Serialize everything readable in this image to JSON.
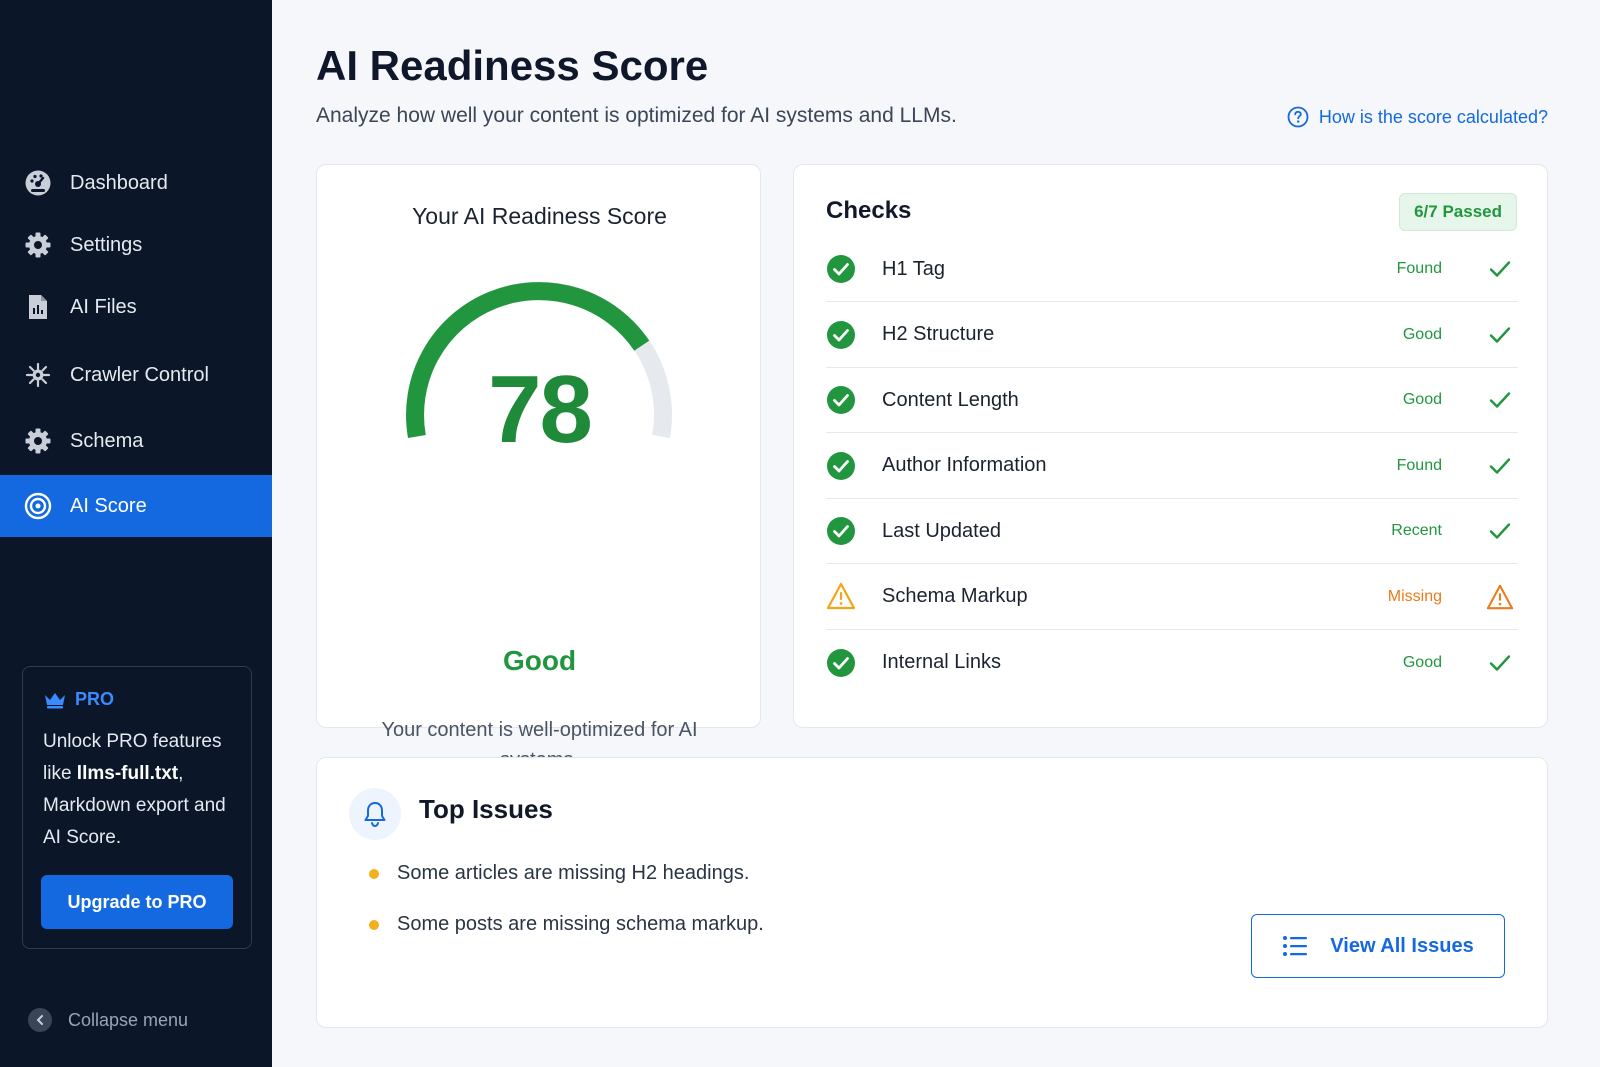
{
  "sidebar": {
    "items": [
      {
        "label": "Dashboard",
        "icon": "dashboard-icon"
      },
      {
        "label": "Settings",
        "icon": "gear-icon"
      },
      {
        "label": "AI Files",
        "icon": "file-icon"
      },
      {
        "label": "Crawler Control",
        "icon": "crawler-icon"
      },
      {
        "label": "Schema",
        "icon": "gear-icon"
      },
      {
        "label": "AI Score",
        "icon": "target-icon",
        "active": true
      }
    ],
    "pro": {
      "badge": "PRO",
      "text_before": "Unlock PRO features like ",
      "text_bold": "llms-full.txt",
      "text_after": ", Markdown export and AI Score.",
      "button": "Upgrade to PRO"
    },
    "collapse_label": "Collapse menu"
  },
  "header": {
    "title": "AI Readiness Score",
    "subtitle": "Analyze how well your content is optimized for AI systems and LLMs.",
    "help_link": "How is the score calculated?"
  },
  "score_card": {
    "title": "Your AI Readiness Score",
    "score": "78",
    "score_value": 78,
    "score_max": 100,
    "rating": "Good",
    "description": "Your content is well-optimized for AI systems."
  },
  "checks": {
    "title": "Checks",
    "passed": "6/7 Passed",
    "rows": [
      {
        "name": "H1 Tag",
        "value": "Found",
        "status": "ok"
      },
      {
        "name": "H2 Structure",
        "value": "Good",
        "status": "ok"
      },
      {
        "name": "Content Length",
        "value": "Good",
        "status": "ok"
      },
      {
        "name": "Author Information",
        "value": "Found",
        "status": "ok"
      },
      {
        "name": "Last Updated",
        "value": "Recent",
        "status": "ok"
      },
      {
        "name": "Schema Markup",
        "value": "Missing",
        "status": "warn"
      },
      {
        "name": "Internal Links",
        "value": "Good",
        "status": "ok"
      }
    ]
  },
  "issues": {
    "title": "Top Issues",
    "items": [
      "Some articles are missing H2 headings.",
      "Some posts are missing schema markup."
    ],
    "button": "View All Issues"
  },
  "colors": {
    "accent": "#1469e0",
    "success": "#22963f",
    "warning": "#ec7a1c",
    "sidebar_bg": "#0b1628"
  }
}
